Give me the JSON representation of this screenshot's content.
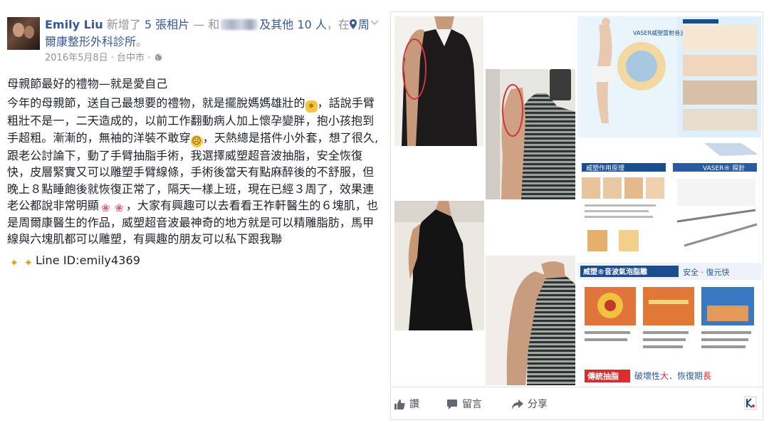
{
  "post": {
    "author": "Emily Liu",
    "header_action_1": " 新增了 ",
    "photos_link": "5 張相片",
    "header_with": " — 和",
    "others_link": "及其他 10 人",
    "header_at": "，在",
    "place_link": "周爾康整形外科診所",
    "header_end": "。",
    "date": "2016年5月8日",
    "location": "台中市",
    "text": {
      "title": "母親節最好的禮物—就是愛自己",
      "p1": "今年的母親節，送自己最想要的禮物，就是擺脫媽媽雄壯的",
      "p2": "，話說手臂粗壯不是一，二天造成的，以前工作翻動病人加上懷孕變胖，抱小孩抱到手超粗。漸漸的，無袖的洋裝不敢穿",
      "p3": "，天熱總是搭件小外套，想了很久,跟老公討論下，動了手臂抽脂手術，我選擇威塑超音波抽脂，安全恢復快，皮層緊實又可以雕塑手臂線條，手術後當天有點麻醉後的不舒服，但晚上８點睡飽後就恢復正常了，隔天一樣上班，現在已經３周了，效果連老公都說非常明顯",
      "p4": "，大家有興趣可以去看看王祚軒醫生的６塊肌，也是周爾康醫生的作品，威塑超音波最神奇的地方就是可以精雕脂肪，馬甲線與六塊肌都可以雕塑，有興趣的朋友可以私下跟我聯",
      "line_id": "Line ID:emily4369"
    }
  },
  "photos": {
    "vaser_title": "VASER威塑雷射音波抽脂",
    "vaser_principle": "威塑作用原理",
    "vaser_probe": "VASER® 探針",
    "banner_title": "威塑®音波氣泡脂雕",
    "banner_tag": "安全 · 復元快",
    "banner_bottom_left": "傳統抽脂",
    "banner_bottom_right_1": "破壞性",
    "banner_bottom_right_2": "大",
    "banner_bottom_right_3": "．恢復期",
    "banner_bottom_right_4": "長"
  },
  "actions": {
    "like": "讚",
    "comment": "留言",
    "share": "分享"
  },
  "icons": [
    "chevron-down-icon",
    "map-pin-icon",
    "globe-icon",
    "like-icon",
    "comment-icon",
    "share-icon"
  ],
  "colors": {
    "link": "#365899",
    "meta": "#90949c",
    "text": "#1d2129",
    "marker": "#d0343f"
  }
}
